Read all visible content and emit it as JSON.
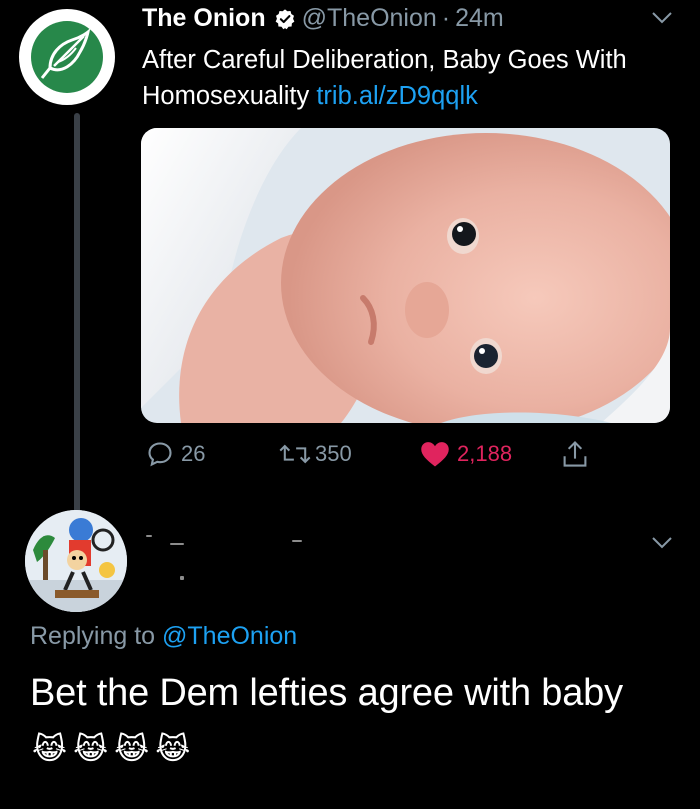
{
  "tweet": {
    "display_name": "The Onion",
    "handle": "@TheOnion",
    "separator": "·",
    "time": "24m",
    "text": "After Careful Deliberation, Baby Goes With Homosexuality",
    "link": "trib.al/zD9qqlk",
    "stats": {
      "replies": "26",
      "retweets": "350",
      "likes": "2,188"
    }
  },
  "reply": {
    "replying_prefix": "Replying to",
    "replying_to": "@TheOnion",
    "text": "Bet the Dem lefties agree with baby",
    "emoji": [
      "😹",
      "😹",
      "😹",
      "😹"
    ]
  },
  "colors": {
    "background": "#000000",
    "muted": "#8899a6",
    "link": "#1da1f2",
    "like": "#e0245e",
    "onion_green": "#27884a"
  },
  "icons": {
    "verified": "verified-badge-icon",
    "caret": "chevron-down-icon",
    "reply": "reply-bubble-icon",
    "retweet": "retweet-icon",
    "like": "heart-icon",
    "share": "share-icon"
  }
}
